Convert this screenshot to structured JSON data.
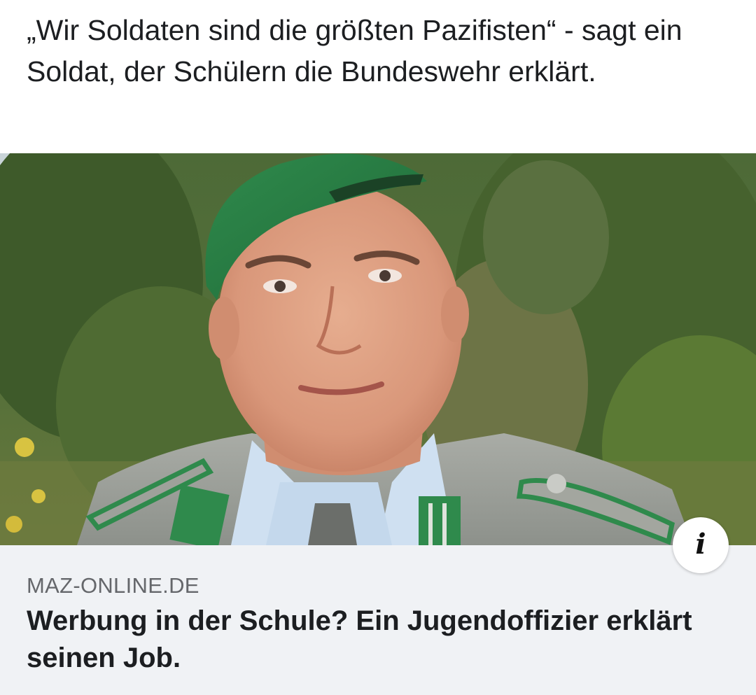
{
  "post": {
    "text": "„Wir Soldaten sind die größten Pazifisten“ - sagt ein Soldat, der Schülern die Bundeswehr erklärt."
  },
  "link_preview": {
    "domain": "MAZ-ONLINE.DE",
    "title": "Werbung in der Schule? Ein Jugendoffizier erklärt seinen Job.",
    "info_icon": "info-icon"
  },
  "colors": {
    "card_background": "#f0f2f5",
    "domain_text": "#65676b",
    "primary_text": "#1c1e21"
  }
}
